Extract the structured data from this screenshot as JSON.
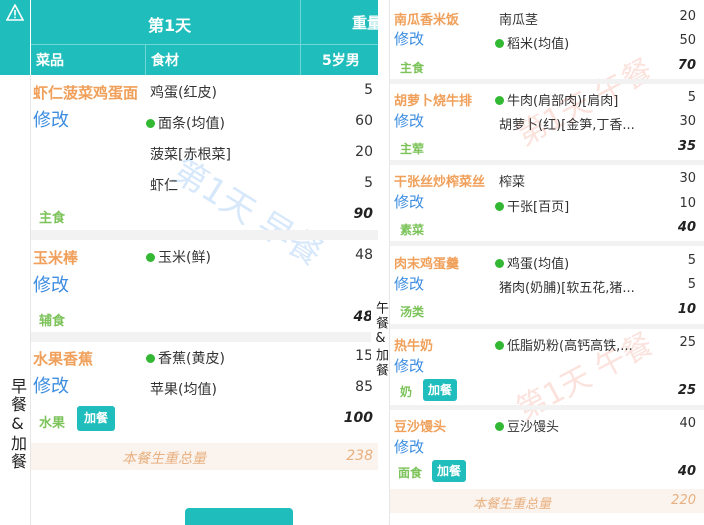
{
  "colors": {
    "accent": "#1fbdbb",
    "dish": "#f0a05a",
    "edit": "#3c8de0",
    "tag": "#7cc35a",
    "dot": "#33b833"
  },
  "header": {
    "warning_icon": "warning-icon",
    "day": "第1天",
    "weight_partial": "重量",
    "col_dish": "菜品",
    "col_ingredient": "食材",
    "col_age": "5岁男"
  },
  "left_meal": {
    "label": "早餐&加餐",
    "watermark": "第1天 早餐",
    "dishes": [
      {
        "name": "虾仁菠菜鸡蛋面",
        "edit": "修改",
        "tag": "主食",
        "total": "90",
        "ingredients": [
          {
            "name": "鸡蛋(红皮)",
            "dot": false,
            "qty": "5"
          },
          {
            "name": "面条(均值)",
            "dot": true,
            "qty": "60"
          },
          {
            "name": "菠菜[赤根菜]",
            "dot": false,
            "qty": "20"
          },
          {
            "name": "虾仁",
            "dot": false,
            "qty": "5"
          }
        ]
      },
      {
        "name": "玉米棒",
        "edit": "修改",
        "tag": "辅食",
        "total": "48",
        "ingredients": [
          {
            "name": "玉米(鲜)",
            "dot": true,
            "qty": "48"
          }
        ]
      },
      {
        "name": "水果香蕉",
        "edit": "修改",
        "tag": "水果",
        "extra": "加餐",
        "total": "100",
        "ingredients": [
          {
            "name": "香蕉(黄皮)",
            "dot": true,
            "qty": "15"
          },
          {
            "name": "苹果(均值)",
            "dot": false,
            "qty": "85"
          }
        ]
      }
    ],
    "summary_label": "本餐生重总量",
    "summary_value": "238"
  },
  "right_meal": {
    "label": "午餐&加餐",
    "watermark": "第1天 午餐",
    "dishes": [
      {
        "name": "南瓜香米饭",
        "edit": "修改",
        "tag": "主食",
        "total": "70",
        "ingredients": [
          {
            "name": "南瓜茎",
            "dot": false,
            "qty": "20"
          },
          {
            "name": "稻米(均值)",
            "dot": true,
            "qty": "50"
          }
        ]
      },
      {
        "name": "胡萝卜烧牛排",
        "edit": "修改",
        "tag": "主荤",
        "total": "35",
        "ingredients": [
          {
            "name": "牛肉(肩部肉)[肩肉]",
            "dot": true,
            "qty": "5"
          },
          {
            "name": "胡萝卜(红)[金笋,丁香...",
            "dot": false,
            "qty": "30"
          }
        ]
      },
      {
        "name": "干张丝炒榨菜丝",
        "edit": "修改",
        "tag": "素菜",
        "total": "40",
        "ingredients": [
          {
            "name": "榨菜",
            "dot": false,
            "qty": "30"
          },
          {
            "name": "干张[百页]",
            "dot": true,
            "qty": "10"
          }
        ]
      },
      {
        "name": "肉末鸡蛋羹",
        "edit": "修改",
        "tag": "汤类",
        "total": "10",
        "ingredients": [
          {
            "name": "鸡蛋(均值)",
            "dot": true,
            "qty": "5"
          },
          {
            "name": "猪肉(奶脯)[软五花,猪...",
            "dot": false,
            "qty": "5"
          }
        ]
      },
      {
        "name": "热牛奶",
        "edit": "修改",
        "tag": "奶",
        "extra": "加餐",
        "total": "25",
        "ingredients": [
          {
            "name": "低脂奶粉(高钙高铁,...",
            "dot": true,
            "qty": "25"
          }
        ]
      },
      {
        "name": "豆沙馒头",
        "edit": "修改",
        "tag": "面食",
        "extra": "加餐",
        "total": "40",
        "ingredients": [
          {
            "name": "豆沙馒头",
            "dot": true,
            "qty": "40"
          }
        ]
      }
    ],
    "summary_label": "本餐生重总量",
    "summary_value": "220"
  }
}
